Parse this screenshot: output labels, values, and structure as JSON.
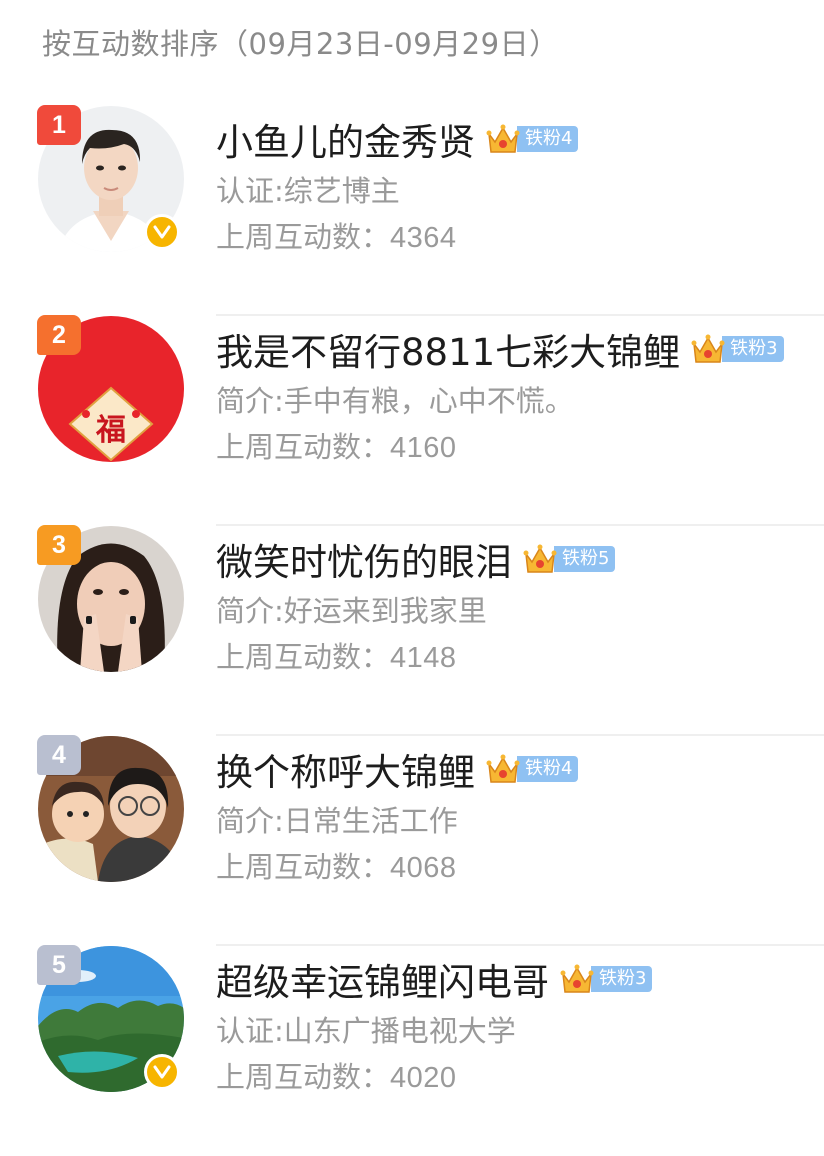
{
  "header": {
    "title": "按互动数排序（09月23日-09月29日）"
  },
  "colors": {
    "rank_1": "#f04a3b",
    "rank_2": "#f5702e",
    "rank_3": "#f79b22",
    "rank_other": "#b9bfd0",
    "badge": "#8fc1f2",
    "verified": "#f7b500",
    "secondary_text": "#9a9a9a"
  },
  "users": [
    {
      "rank": "1",
      "name": "小鱼儿的金秀贤",
      "badge": "铁粉4",
      "desc": "认证:综艺博主",
      "stat_label": "上周互动数：",
      "stat_value": "4364",
      "verified": true,
      "avatar": "man-portrait"
    },
    {
      "rank": "2",
      "name": "我是不留行8811七彩大锦鲤",
      "badge": "铁粉3",
      "desc": "简介:手中有粮，心中不慌。",
      "stat_label": "上周互动数：",
      "stat_value": "4160",
      "verified": false,
      "avatar": "fu-red"
    },
    {
      "rank": "3",
      "name": "微笑时忧伤的眼泪",
      "badge": "铁粉5",
      "desc": "简介:好运来到我家里",
      "stat_label": "上周互动数：",
      "stat_value": "4148",
      "verified": false,
      "avatar": "woman-hands"
    },
    {
      "rank": "4",
      "name": "换个称呼大锦鲤",
      "badge": "铁粉4",
      "desc": "简介:日常生活工作",
      "stat_label": "上周互动数：",
      "stat_value": "4068",
      "verified": false,
      "avatar": "cartoon-couple"
    },
    {
      "rank": "5",
      "name": "超级幸运锦鲤闪电哥",
      "badge": "铁粉3",
      "desc": "认证:山东广播电视大学",
      "stat_label": "上周互动数：",
      "stat_value": "4020",
      "verified": true,
      "avatar": "landscape"
    }
  ],
  "fu_char": "福"
}
